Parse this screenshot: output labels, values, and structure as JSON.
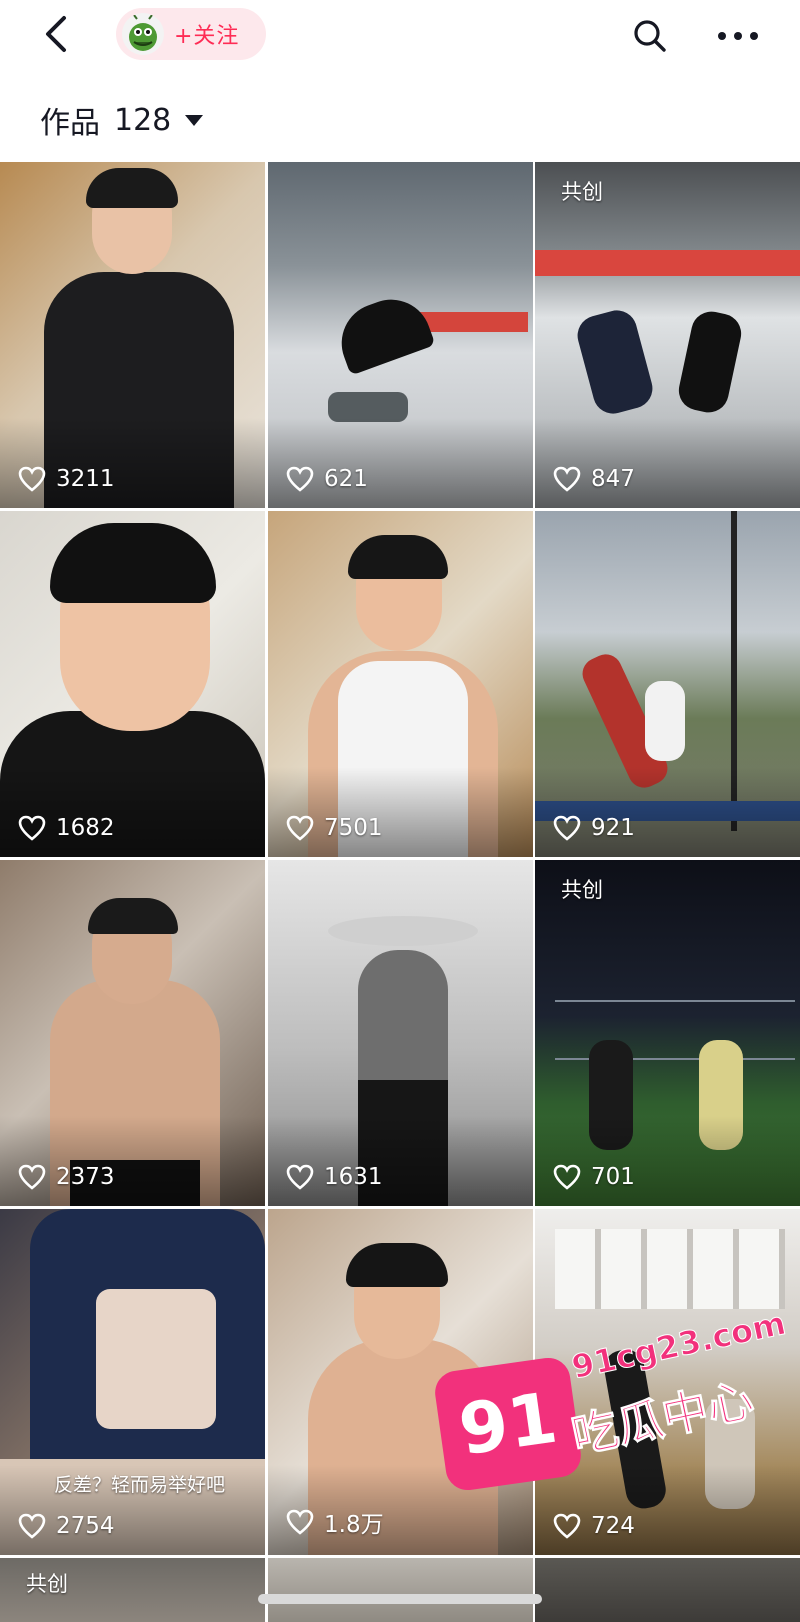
{
  "topbar": {
    "back_icon": "chevron-left-icon",
    "avatar_icon": "green-creature-avatar",
    "follow_label": "+关注",
    "search_icon": "search-icon",
    "more_icon": "more-horizontal-icon"
  },
  "works": {
    "label": "作品",
    "count": "128"
  },
  "tiles": [
    {
      "likes": "3211",
      "badge": "",
      "caption": ""
    },
    {
      "likes": "621",
      "badge": "",
      "caption": ""
    },
    {
      "likes": "847",
      "badge": "共创",
      "caption": ""
    },
    {
      "likes": "1682",
      "badge": "",
      "caption": ""
    },
    {
      "likes": "7501",
      "badge": "",
      "caption": ""
    },
    {
      "likes": "921",
      "badge": "",
      "caption": ""
    },
    {
      "likes": "2373",
      "badge": "",
      "caption": ""
    },
    {
      "likes": "1631",
      "badge": "",
      "caption": ""
    },
    {
      "likes": "701",
      "badge": "共创",
      "caption": ""
    },
    {
      "likes": "2754",
      "badge": "",
      "caption": "反差？轻而易举好吧"
    },
    {
      "likes": "1.8万",
      "badge": "",
      "caption": ""
    },
    {
      "likes": "724",
      "badge": "",
      "caption": ""
    },
    {
      "likes": "",
      "badge": "共创",
      "caption": ""
    }
  ],
  "watermark": {
    "number": "91",
    "domain": "91cg23.com",
    "text": "吃瓜中心"
  },
  "colors": {
    "accent": "#fe2c55",
    "pill_bg": "#fde8ec",
    "watermark": "#f2317c"
  }
}
